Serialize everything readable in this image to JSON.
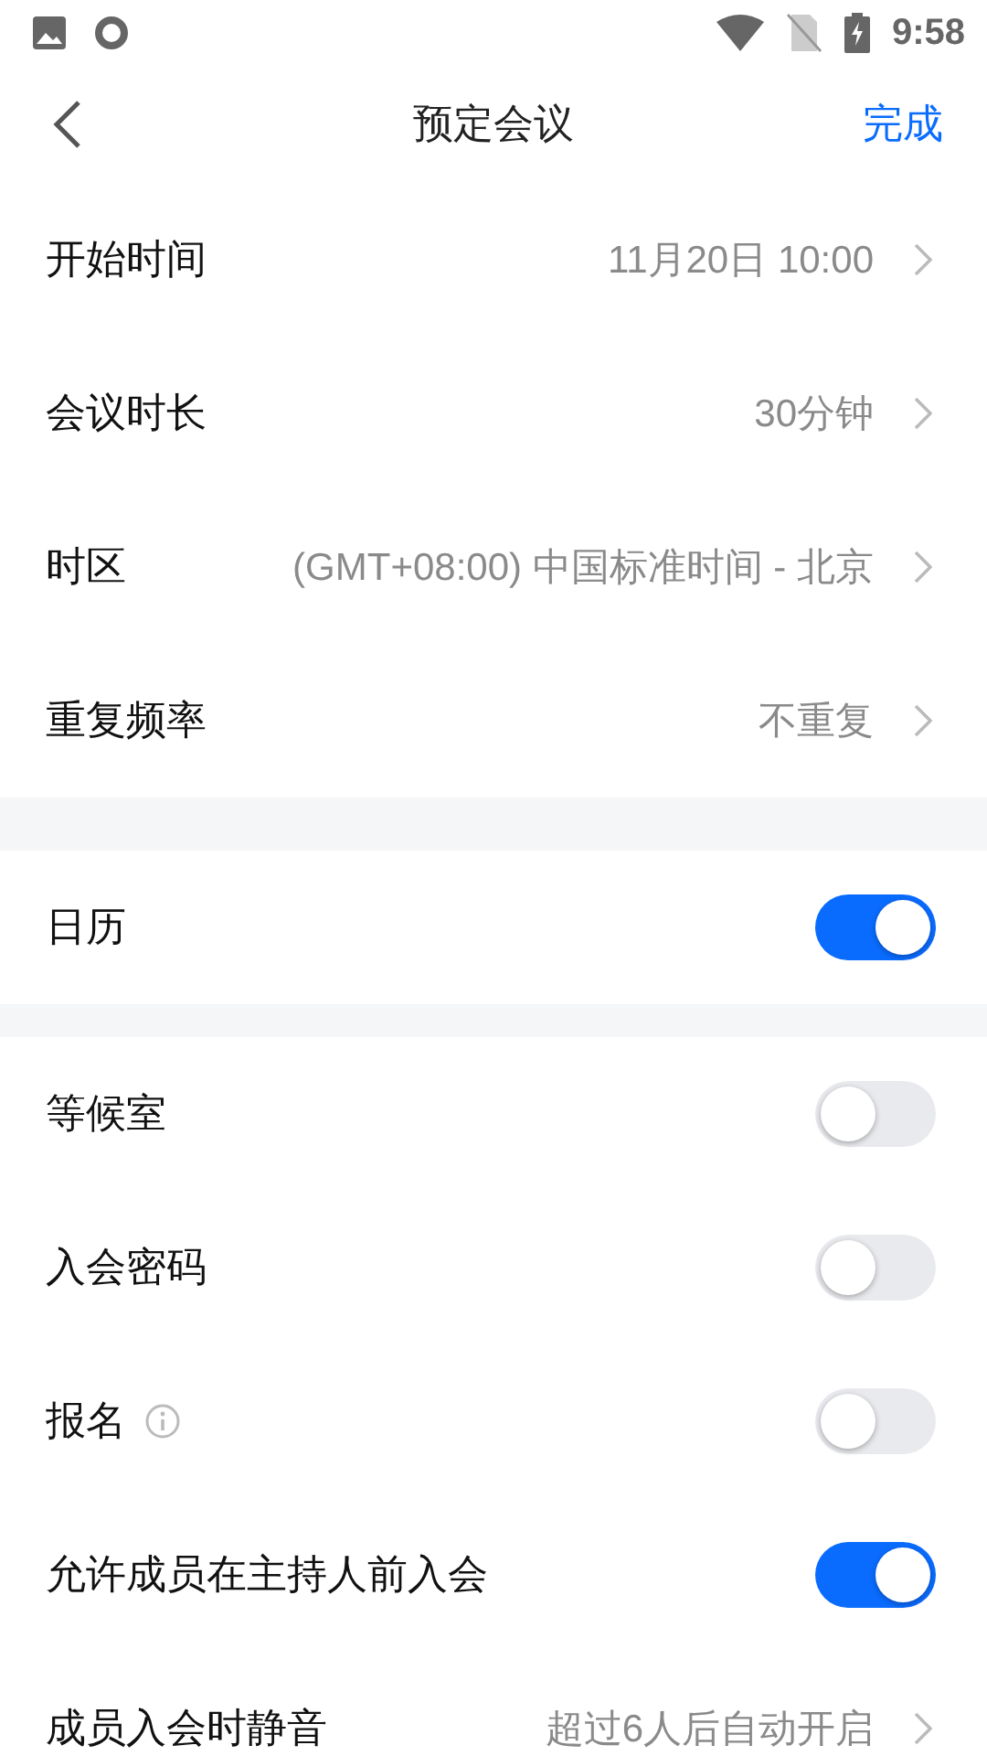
{
  "status_bar": {
    "time": "9:58"
  },
  "nav": {
    "title": "预定会议",
    "action": "完成"
  },
  "sections": [
    {
      "rows": [
        {
          "kind": "nav",
          "label": "开始时间",
          "value": "11月20日 10:00"
        },
        {
          "kind": "nav",
          "label": "会议时长",
          "value": "30分钟"
        },
        {
          "kind": "nav",
          "label": "时区",
          "value": "(GMT+08:00) 中国标准时间 - 北京"
        },
        {
          "kind": "nav",
          "label": "重复频率",
          "value": "不重复"
        }
      ]
    },
    {
      "rows": [
        {
          "kind": "toggle",
          "label": "日历",
          "on": true
        }
      ]
    },
    {
      "rows": [
        {
          "kind": "toggle",
          "label": "等候室",
          "on": false
        },
        {
          "kind": "toggle",
          "label": "入会密码",
          "on": false
        },
        {
          "kind": "toggle",
          "label": "报名",
          "on": false,
          "info": true
        },
        {
          "kind": "toggle",
          "label": "允许成员在主持人前入会",
          "on": true
        },
        {
          "kind": "nav",
          "label": "成员入会时静音",
          "value": "超过6人后自动开启"
        }
      ]
    }
  ]
}
